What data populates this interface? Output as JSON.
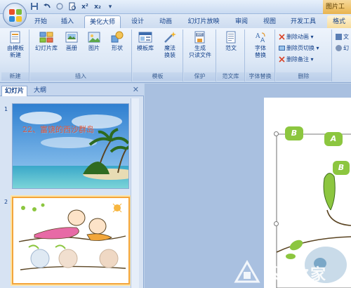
{
  "title_bar": {
    "context_tab_label": "图片工",
    "qat": [
      "save-icon",
      "undo-icon",
      "redo-icon",
      "print-preview-icon",
      "superscript-icon",
      "subscript-icon",
      "customize-icon"
    ],
    "qat_glyphs": {
      "superscript": "x²",
      "subscript": "x₂"
    }
  },
  "tabs": [
    "开始",
    "插入",
    "美化大师",
    "设计",
    "动画",
    "幻灯片放映",
    "审阅",
    "视图",
    "开发工具",
    "格式"
  ],
  "active_tab": "美化大师",
  "ribbon": {
    "groups": [
      {
        "label": "新建",
        "buttons": [
          {
            "label": "由模板\n新建",
            "icon": "template-icon"
          }
        ]
      },
      {
        "label": "插入",
        "buttons": [
          {
            "label": "幻灯片库",
            "icon": "slide-library-icon"
          },
          {
            "label": "画册",
            "icon": "album-icon"
          },
          {
            "label": "图片",
            "icon": "picture-icon"
          },
          {
            "label": "形状",
            "icon": "shape-icon"
          }
        ]
      },
      {
        "label": "模板",
        "buttons": [
          {
            "label": "模板库",
            "icon": "template-library-icon"
          },
          {
            "label": "魔法\n换装",
            "icon": "magic-wand-icon"
          }
        ]
      },
      {
        "label": "保护",
        "buttons": [
          {
            "label": "生成\n只读文件",
            "icon": "ppt-readonly-icon"
          }
        ]
      },
      {
        "label": "范文库",
        "buttons": [
          {
            "label": "范文",
            "icon": "sample-doc-icon"
          }
        ]
      },
      {
        "label": "字体替换",
        "buttons": [
          {
            "label": "字体\n替换",
            "icon": "font-replace-icon"
          }
        ]
      },
      {
        "label": "删除",
        "buttons": [
          {
            "label": "删除动画",
            "icon": "delete-animation-icon"
          },
          {
            "label": "删除页切换",
            "icon": "delete-transition-icon"
          },
          {
            "label": "删除备注",
            "icon": "delete-notes-icon"
          }
        ]
      }
    ],
    "overflow": [
      "文",
      "幻"
    ]
  },
  "left_pane": {
    "tabs": [
      "幻灯片",
      "大纲"
    ],
    "active_tab": "幻灯片",
    "close_glyph": "✕",
    "slides": [
      {
        "number": "1",
        "title": "22、富饶的西沙群岛"
      },
      {
        "number": "2",
        "title": ""
      }
    ]
  },
  "slide_letters": [
    "B",
    "A",
    "B"
  ],
  "colors": {
    "accent": "#f3a53c",
    "ribbon_text": "#15428b",
    "slide_title": "#e2573a",
    "letter_bubble": "#8cc63f"
  },
  "watermark": "系统之家"
}
